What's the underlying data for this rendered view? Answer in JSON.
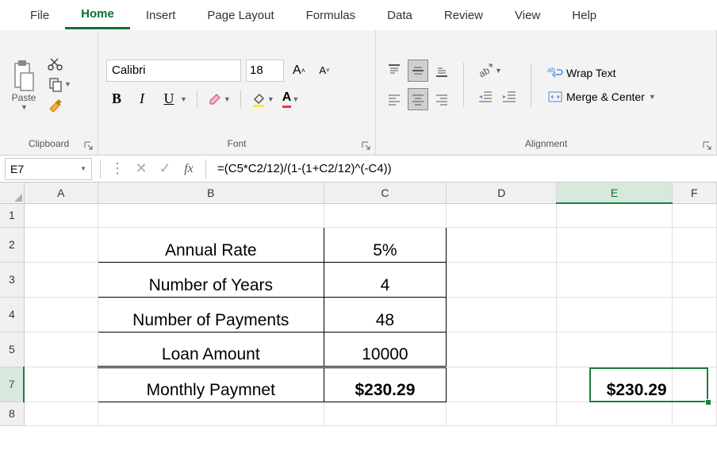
{
  "tabs": [
    "File",
    "Home",
    "Insert",
    "Page Layout",
    "Formulas",
    "Data",
    "Review",
    "View",
    "Help"
  ],
  "activeTab": "Home",
  "clipboard": {
    "paste": "Paste",
    "group": "Clipboard"
  },
  "font": {
    "name": "Calibri",
    "size": "18",
    "group": "Font"
  },
  "alignment": {
    "wrap": "Wrap Text",
    "merge": "Merge & Center",
    "group": "Alignment"
  },
  "nameBox": "E7",
  "formula": "=(C5*C2/12)/(1-(1+C2/12)^(-C4))",
  "columns": [
    "A",
    "B",
    "C",
    "D",
    "E",
    "F"
  ],
  "rows": [
    "1",
    "2",
    "3",
    "4",
    "5",
    "7",
    "8"
  ],
  "data": {
    "b2": "Annual Rate",
    "c2": "5%",
    "b3": "Number of Years",
    "c3": "4",
    "b4": "Number of Payments",
    "c4": "48",
    "b5": "Loan Amount",
    "c5": "10000",
    "b7": "Monthly Paymnet",
    "c7": "$230.29",
    "e7": "$230.29"
  },
  "colWidths": {
    "A": 100,
    "B": 300,
    "C": 160,
    "D": 150,
    "E": 150,
    "F": 60
  },
  "rowHeights": {
    "1": 30,
    "2": 44,
    "3": 44,
    "4": 44,
    "5": 44,
    "7": 44,
    "8": 30
  },
  "chart_data": {
    "type": "table",
    "title": "Loan payment calculation",
    "rows": [
      {
        "label": "Annual Rate",
        "value": "5%"
      },
      {
        "label": "Number of Years",
        "value": 4
      },
      {
        "label": "Number of Payments",
        "value": 48
      },
      {
        "label": "Loan Amount",
        "value": 10000
      },
      {
        "label": "Monthly Paymnet",
        "value": 230.29
      }
    ]
  }
}
